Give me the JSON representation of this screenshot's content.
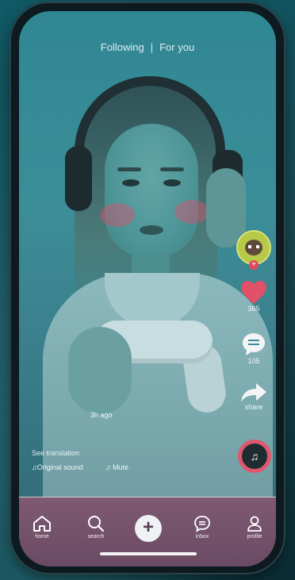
{
  "top_tabs": {
    "following": "Following",
    "separator": "|",
    "for_you": "For you"
  },
  "rail": {
    "likes_count": "365",
    "comments_count": "105",
    "share_label": "share",
    "follow_symbol": "+",
    "disc_symbol": "♫"
  },
  "caption": {
    "time_ago": "3h ago",
    "see_translation": "See translation",
    "original_sound": "♫Original sound",
    "mute": "♫ Mute"
  },
  "nav": {
    "home": "home",
    "search": "search",
    "create_symbol": "+",
    "inbox": "inbox",
    "profile": "profile"
  },
  "colors": {
    "like": "#e05068",
    "disc_ring": "#e0576d",
    "nav_bg": "#7e5a72"
  }
}
